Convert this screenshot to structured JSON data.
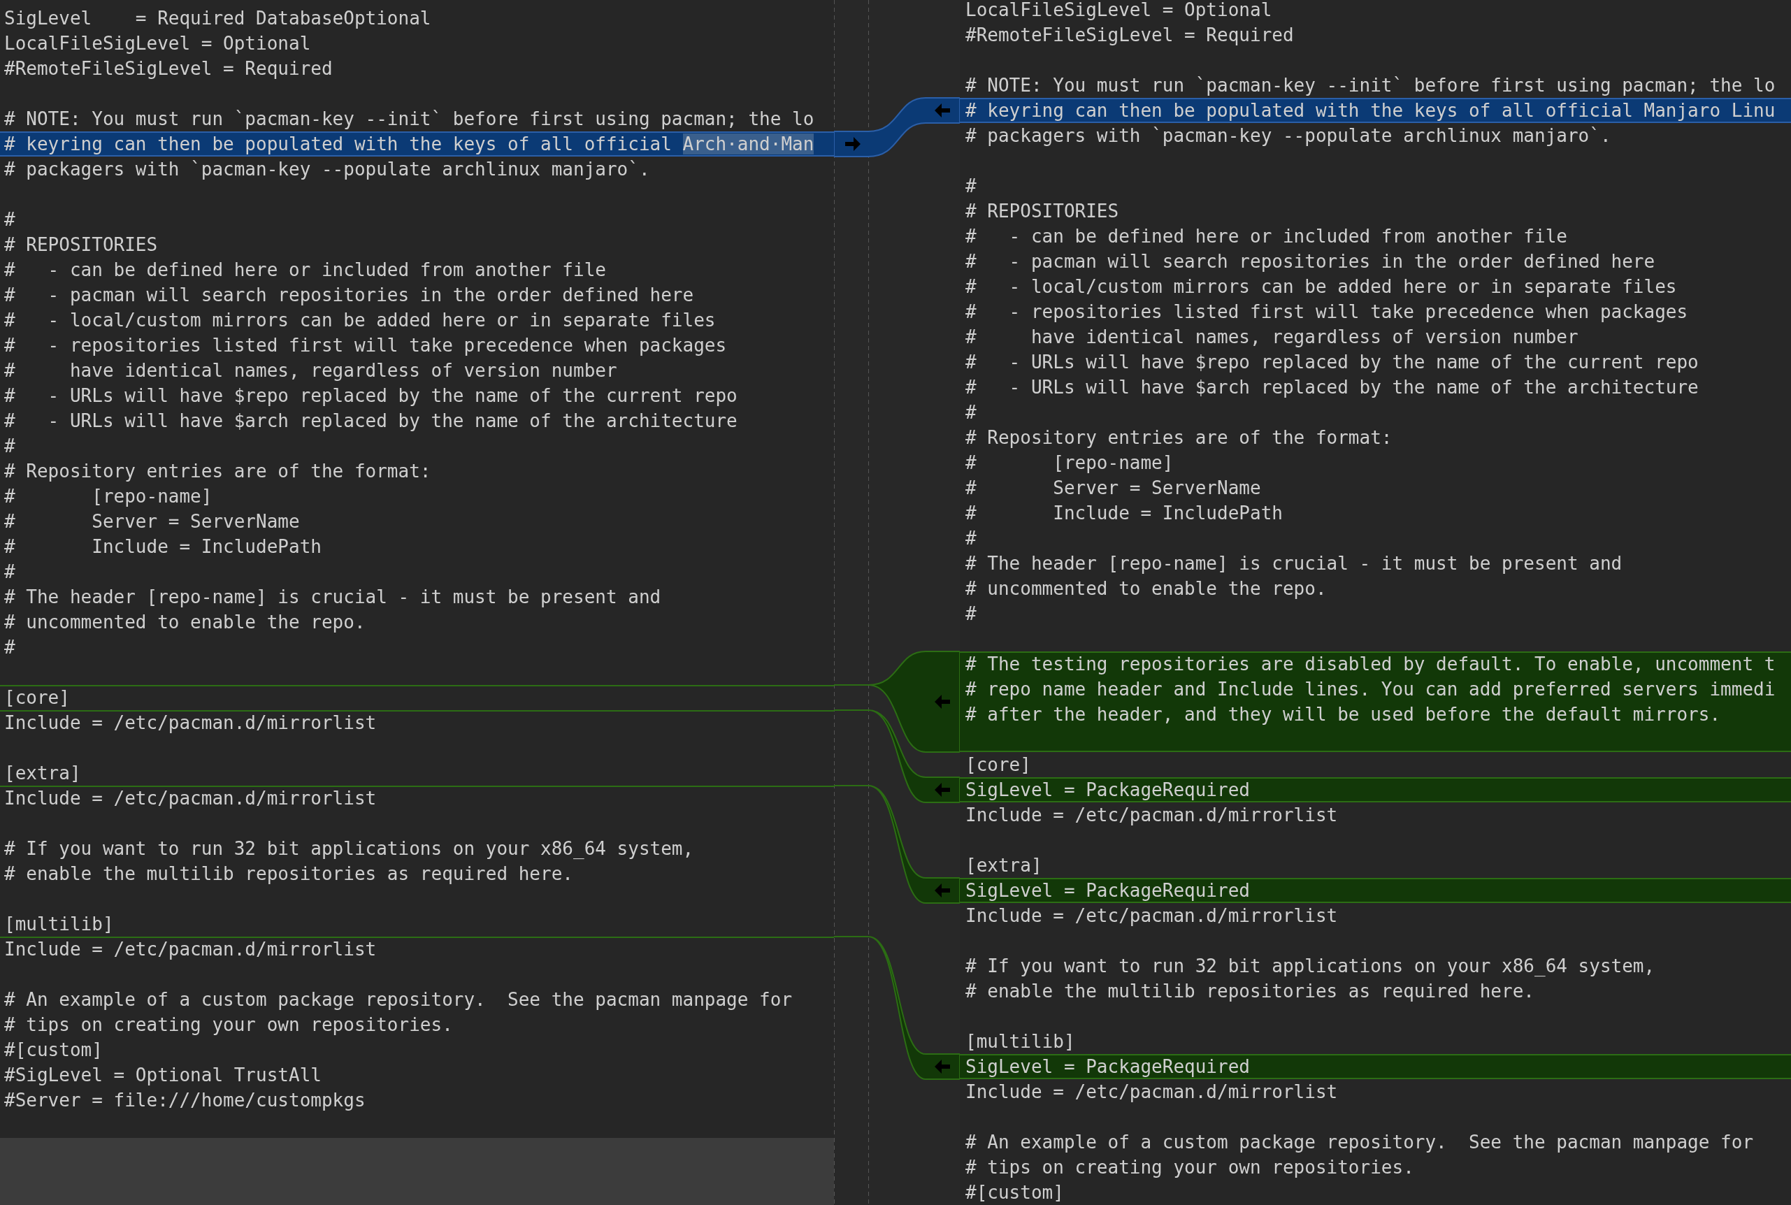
{
  "left_pane": {
    "lines": [
      {
        "kind": "plain",
        "text": "SigLevel    = Required DatabaseOptional"
      },
      {
        "kind": "plain",
        "text": "LocalFileSigLevel = Optional"
      },
      {
        "kind": "plain",
        "text": "#RemoteFileSigLevel = Required"
      },
      {
        "kind": "plain"
      },
      {
        "kind": "plain",
        "text": "# NOTE: You must run `pacman-key --init` before first using pacman; the lo"
      },
      {
        "kind": "changed",
        "text": "# keyring can then be populated with the keys of all official ",
        "inline_change": "Arch·and·Man"
      },
      {
        "kind": "plain",
        "text": "# packagers with `pacman-key --populate archlinux manjaro`."
      },
      {
        "kind": "plain"
      },
      {
        "kind": "plain",
        "text": "#"
      },
      {
        "kind": "plain",
        "text": "# REPOSITORIES"
      },
      {
        "kind": "plain",
        "text": "#   - can be defined here or included from another file"
      },
      {
        "kind": "plain",
        "text": "#   - pacman will search repositories in the order defined here"
      },
      {
        "kind": "plain",
        "text": "#   - local/custom mirrors can be added here or in separate files"
      },
      {
        "kind": "plain",
        "text": "#   - repositories listed first will take precedence when packages"
      },
      {
        "kind": "plain",
        "text": "#     have identical names, regardless of version number"
      },
      {
        "kind": "plain",
        "text": "#   - URLs will have $repo replaced by the name of the current repo"
      },
      {
        "kind": "plain",
        "text": "#   - URLs will have $arch replaced by the name of the architecture"
      },
      {
        "kind": "plain",
        "text": "#"
      },
      {
        "kind": "plain",
        "text": "# Repository entries are of the format:"
      },
      {
        "kind": "plain",
        "text": "#       [repo-name]"
      },
      {
        "kind": "plain",
        "text": "#       Server = ServerName"
      },
      {
        "kind": "plain",
        "text": "#       Include = IncludePath"
      },
      {
        "kind": "plain",
        "text": "#"
      },
      {
        "kind": "plain",
        "text": "# The header [repo-name] is crucial - it must be present and"
      },
      {
        "kind": "plain",
        "text": "# uncommented to enable the repo."
      },
      {
        "kind": "plain",
        "text": "#"
      },
      {
        "kind": "plain"
      },
      {
        "kind": "after_insertion",
        "text": "[core]"
      },
      {
        "kind": "after_insertion",
        "text": "Include = /etc/pacman.d/mirrorlist"
      },
      {
        "kind": "plain"
      },
      {
        "kind": "plain",
        "text": "[extra]"
      },
      {
        "kind": "after_insertion",
        "text": "Include = /etc/pacman.d/mirrorlist"
      },
      {
        "kind": "plain"
      },
      {
        "kind": "plain",
        "text": "# If you want to run 32 bit applications on your x86_64 system,"
      },
      {
        "kind": "plain",
        "text": "# enable the multilib repositories as required here."
      },
      {
        "kind": "plain"
      },
      {
        "kind": "plain",
        "text": "[multilib]"
      },
      {
        "kind": "after_insertion",
        "text": "Include = /etc/pacman.d/mirrorlist"
      },
      {
        "kind": "plain"
      },
      {
        "kind": "plain",
        "text": "# An example of a custom package repository.  See the pacman manpage for"
      },
      {
        "kind": "plain",
        "text": "# tips on creating your own repositories."
      },
      {
        "kind": "plain",
        "text": "#[custom]"
      },
      {
        "kind": "plain",
        "text": "#SigLevel = Optional TrustAll"
      },
      {
        "kind": "plain",
        "text": "#Server = file:///home/custompkgs"
      },
      {
        "kind": "plain"
      }
    ]
  },
  "right_pane": {
    "lines": [
      {
        "kind": "plain",
        "text": "LocalFileSigLevel = Optional"
      },
      {
        "kind": "plain",
        "text": "#RemoteFileSigLevel = Required"
      },
      {
        "kind": "plain"
      },
      {
        "kind": "plain",
        "text": "# NOTE: You must run `pacman-key --init` before first using pacman; the lo"
      },
      {
        "kind": "changed",
        "text": "# keyring can then be populated with the keys of all official Manjaro Linu"
      },
      {
        "kind": "plain",
        "text": "# packagers with `pacman-key --populate archlinux manjaro`."
      },
      {
        "kind": "plain"
      },
      {
        "kind": "plain",
        "text": "#"
      },
      {
        "kind": "plain",
        "text": "# REPOSITORIES"
      },
      {
        "kind": "plain",
        "text": "#   - can be defined here or included from another file"
      },
      {
        "kind": "plain",
        "text": "#   - pacman will search repositories in the order defined here"
      },
      {
        "kind": "plain",
        "text": "#   - local/custom mirrors can be added here or in separate files"
      },
      {
        "kind": "plain",
        "text": "#   - repositories listed first will take precedence when packages"
      },
      {
        "kind": "plain",
        "text": "#     have identical names, regardless of version number"
      },
      {
        "kind": "plain",
        "text": "#   - URLs will have $repo replaced by the name of the current repo"
      },
      {
        "kind": "plain",
        "text": "#   - URLs will have $arch replaced by the name of the architecture"
      },
      {
        "kind": "plain",
        "text": "#"
      },
      {
        "kind": "plain",
        "text": "# Repository entries are of the format:"
      },
      {
        "kind": "plain",
        "text": "#       [repo-name]"
      },
      {
        "kind": "plain",
        "text": "#       Server = ServerName"
      },
      {
        "kind": "plain",
        "text": "#       Include = IncludePath"
      },
      {
        "kind": "plain",
        "text": "#"
      },
      {
        "kind": "plain",
        "text": "# The header [repo-name] is crucial - it must be present and"
      },
      {
        "kind": "plain",
        "text": "# uncommented to enable the repo."
      },
      {
        "kind": "plain",
        "text": "#"
      },
      {
        "kind": "plain"
      },
      {
        "kind": "inserted",
        "text": "# The testing repositories are disabled by default. To enable, uncomment t"
      },
      {
        "kind": "inserted",
        "text": "# repo name header and Include lines. You can add preferred servers immedi"
      },
      {
        "kind": "inserted",
        "text": "# after the header, and they will be used before the default mirrors."
      },
      {
        "kind": "inserted"
      },
      {
        "kind": "plain",
        "text": "[core]"
      },
      {
        "kind": "inserted",
        "text": "SigLevel = PackageRequired"
      },
      {
        "kind": "plain",
        "text": "Include = /etc/pacman.d/mirrorlist"
      },
      {
        "kind": "plain"
      },
      {
        "kind": "plain",
        "text": "[extra]"
      },
      {
        "kind": "inserted",
        "text": "SigLevel = PackageRequired"
      },
      {
        "kind": "plain",
        "text": "Include = /etc/pacman.d/mirrorlist"
      },
      {
        "kind": "plain"
      },
      {
        "kind": "plain",
        "text": "# If you want to run 32 bit applications on your x86_64 system,"
      },
      {
        "kind": "plain",
        "text": "# enable the multilib repositories as required here."
      },
      {
        "kind": "plain"
      },
      {
        "kind": "plain",
        "text": "[multilib]"
      },
      {
        "kind": "inserted",
        "text": "SigLevel = PackageRequired"
      },
      {
        "kind": "plain",
        "text": "Include = /etc/pacman.d/mirrorlist"
      },
      {
        "kind": "plain"
      },
      {
        "kind": "plain",
        "text": "# An example of a custom package repository.  See the pacman manpage for"
      },
      {
        "kind": "plain",
        "text": "# tips on creating your own repositories."
      },
      {
        "kind": "plain",
        "text": "#[custom]"
      }
    ]
  }
}
